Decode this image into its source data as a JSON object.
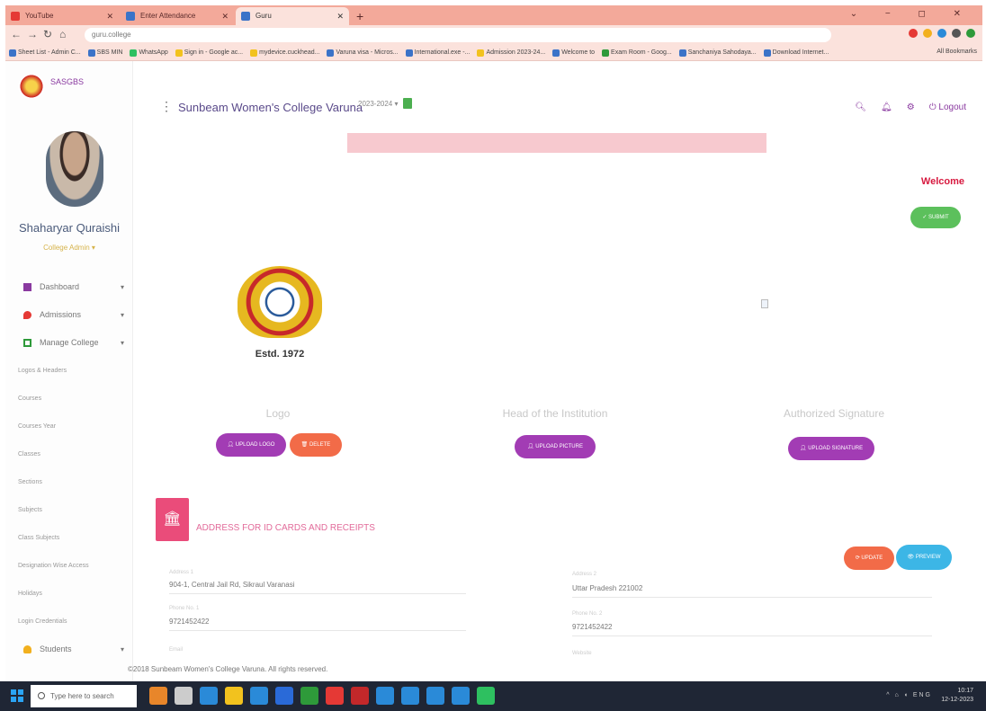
{
  "browser": {
    "tabs": [
      {
        "label": "YouTube",
        "color": "#e53935"
      },
      {
        "label": "Enter Attendance",
        "color": "#3b73c8"
      },
      {
        "label": "Guru",
        "color": "#3b73c8"
      }
    ],
    "new_tab": "+",
    "url": "guru.college",
    "bookmarks": [
      "Sheet List - Admin C...",
      "SBS MIN",
      "WhatsApp",
      "Sign in - Google ac...",
      "mydevice.cuckhead...",
      "Varuna visa - Micros...",
      "International.exe -...",
      "Admission 2023-24...",
      "Welcome to",
      "Exam Room - Goog...",
      "Sanchaniya Sahodaya...",
      "Download Internet..."
    ],
    "all_bookmarks": "All Bookmarks"
  },
  "sidebar": {
    "brand": "SASGBS",
    "user_name": "Shaharyar Quraishi",
    "user_role": "College Admin",
    "menu": [
      {
        "label": "Dashboard",
        "icon": "dashboard-icon",
        "color": "#8a3aa0"
      },
      {
        "label": "Admissions",
        "icon": "drop-icon",
        "color": "#e53935"
      },
      {
        "label": "Manage College",
        "icon": "grid-icon",
        "color": "#2e9a3a"
      }
    ],
    "submenu": [
      "Logos & Headers",
      "Courses",
      "Courses Year",
      "Classes",
      "Sections",
      "Subjects",
      "Class Subjects",
      "Designation Wise Access",
      "Holidays",
      "Login Credentials"
    ],
    "students": {
      "label": "Students",
      "color": "#f2b01e"
    }
  },
  "header": {
    "college_name": "Sunbeam Women's College Varuna",
    "session": "2023-2024",
    "logout": "Logout"
  },
  "main": {
    "welcome": "Welcome",
    "submit": "SUBMIT",
    "estd": "Estd. 1972",
    "columns": [
      {
        "title": "Logo"
      },
      {
        "title": "Head of the Institution"
      },
      {
        "title": "Authorized Signature"
      }
    ],
    "buttons": {
      "upload_logo": "UPLOAD LOGO",
      "delete": "DELETE",
      "upload_picture": "UPLOAD PICTURE",
      "upload_signature": "UPLOAD SIGNATURE"
    },
    "address_section": {
      "title": "ADDRESS FOR ID CARDS AND RECEIPTS",
      "update": "UPDATE",
      "preview": "PREVIEW",
      "fields": {
        "address1_label": "Address 1",
        "address1_value": "904-1, Central Jail Rd, Sikraul Varanasi",
        "address2_label": "Address 2",
        "address2_value": "Uttar Pradesh 221002",
        "phone1_label": "Phone No. 1",
        "phone1_value": "9721452422",
        "phone2_label": "Phone No. 2",
        "phone2_value": "9721452422",
        "email_label": "Email",
        "website_label": "Website"
      }
    }
  },
  "footer": "©2018 Sunbeam Women's College Varuna. All rights reserved.",
  "taskbar": {
    "search_placeholder": "Type here to search",
    "time": "10:17",
    "date": "12-12-2023",
    "lang": "ENG",
    "apps": [
      "#e8862a",
      "#cccccc",
      "#2a8ad8",
      "#f2c21e",
      "#2a8ad8",
      "#2a6ad8",
      "#2e9a3a",
      "#e53935",
      "#c2282a",
      "#2a8ad8",
      "#2a8ad8",
      "#2a8ad8",
      "#2a8ad8",
      "#2ec060"
    ]
  }
}
